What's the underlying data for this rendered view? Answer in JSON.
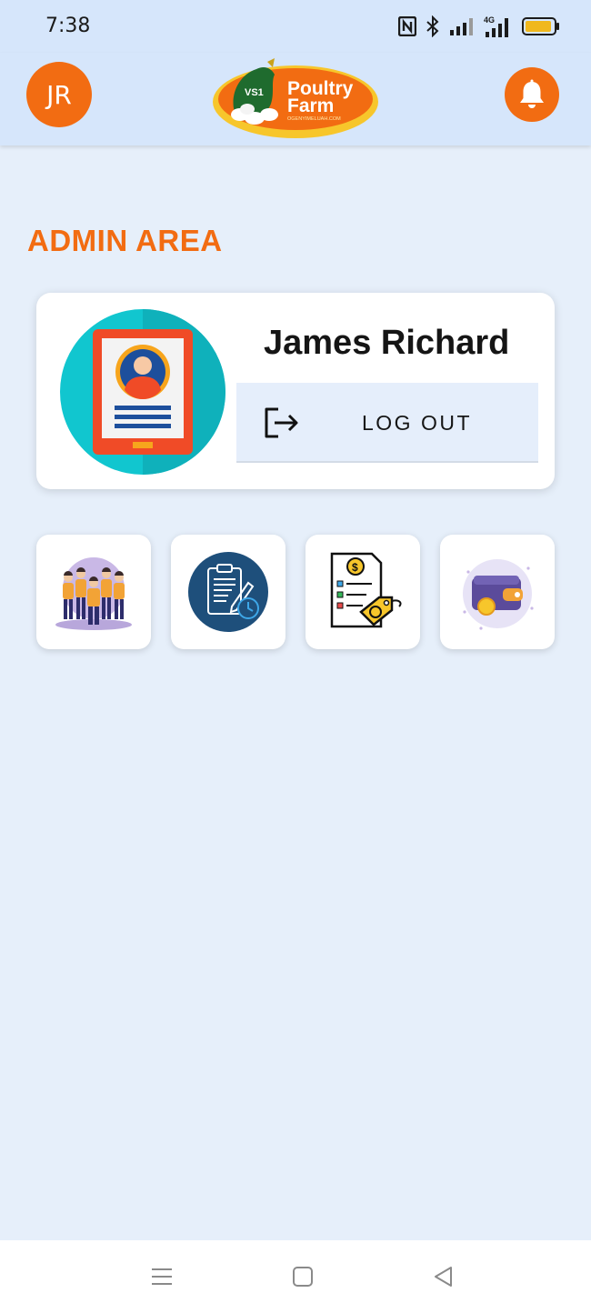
{
  "status_bar": {
    "time": "7:38",
    "icons": [
      "nfc-icon",
      "bluetooth-icon",
      "signal-icon",
      "4g-signal-icon",
      "battery-icon"
    ],
    "network_label": "4G"
  },
  "header": {
    "avatar_initials": "JR",
    "logo": {
      "badge": "VS1",
      "line1": "Poultry",
      "line2": "Farm",
      "tagline": "OGENYIMELUAH.COM"
    },
    "icons": [
      "avatar",
      "logo",
      "bell-icon"
    ]
  },
  "page": {
    "title": "ADMIN AREA"
  },
  "profile": {
    "name": "James Richard",
    "logout_label": "LOG OUT"
  },
  "shortcuts": [
    {
      "icon": "team-icon"
    },
    {
      "icon": "clipboard-report-icon"
    },
    {
      "icon": "invoice-price-tag-icon"
    },
    {
      "icon": "wallet-icon"
    }
  ],
  "navigation": {
    "icons": [
      "menu-icon",
      "home-icon",
      "back-icon"
    ]
  },
  "colors": {
    "accent": "#f26c12",
    "header_bg": "#d6e6fb",
    "page_bg": "#e6effa",
    "card_bg": "#ffffff",
    "logout_bg": "#e5eefb"
  }
}
